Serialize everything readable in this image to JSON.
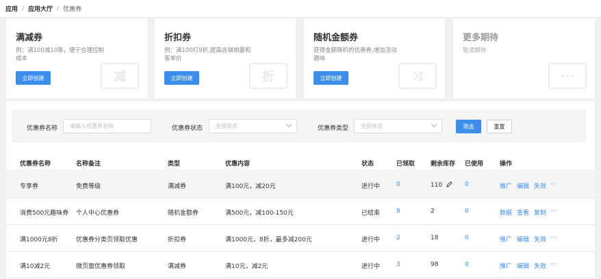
{
  "breadcrumb": [
    "应用",
    "应用大厅",
    "优惠券"
  ],
  "cards": [
    {
      "title": "满减券",
      "desc": "例：满100减10等，便于合理控制成本",
      "button": "立即创建",
      "watermark": "减"
    },
    {
      "title": "折扣券",
      "desc": "例：满100打9折,提高店铺销量和客单价",
      "button": "立即创建",
      "watermark": "折"
    },
    {
      "title": "随机金额券",
      "desc": "获得金额随机的优惠券,增加活动趣味",
      "button": "立即创建",
      "watermark": "⤨"
    },
    {
      "title": "更多期待",
      "desc": "敬请期待",
      "watermark": "···"
    }
  ],
  "filters": {
    "name_label": "优惠券名称",
    "name_placeholder": "请输入优惠券名称",
    "status_label": "优惠券状态",
    "status_value": "全部状态",
    "type_label": "优惠券类型",
    "type_value": "全部状态",
    "filter_button": "筛选",
    "reset_button": "重置"
  },
  "table": {
    "columns": [
      "优惠券名称",
      "名称备注",
      "类型",
      "优惠内容",
      "状态",
      "已领取",
      "剩余库存",
      "已使用",
      "操作"
    ],
    "rows": [
      {
        "name": "专享券",
        "note": "免费等级",
        "type": "满减券",
        "content": "满100元，减20元",
        "status": "进行中",
        "claimed": "0",
        "stock": "110",
        "used": "0",
        "actions": [
          "推广",
          "编辑",
          "失效",
          "···"
        ]
      },
      {
        "name": "消费500元趣味券",
        "note": "个人中心优惠券",
        "type": "随机金额券",
        "content": "满500元，减100-150元",
        "status": "已结束",
        "claimed": "8",
        "stock": "2",
        "used": "0",
        "actions": [
          "数据",
          "查看",
          "复制",
          "···"
        ]
      },
      {
        "name": "满1000元8折",
        "note": "优惠券分类页领取优惠",
        "type": "折扣券",
        "content": "满1000元，8折，最多减200元",
        "status": "进行中",
        "claimed": "2",
        "stock": "18",
        "used": "0",
        "actions": [
          "推广",
          "编辑",
          "失效",
          "···"
        ]
      },
      {
        "name": "满10减2元",
        "note": "微页面优惠券领取",
        "type": "满减券",
        "content": "满10元，减2元",
        "status": "进行中",
        "claimed": "3",
        "stock": "98",
        "used": "0",
        "actions": [
          "推广",
          "编辑",
          "失效",
          "···"
        ]
      }
    ]
  },
  "colors": {
    "accent": "#3d8eea",
    "background": "#f0f0f0"
  },
  "icons": {
    "stock_edit": "pencil-icon",
    "select_arrow": "chevron-down-icon"
  }
}
